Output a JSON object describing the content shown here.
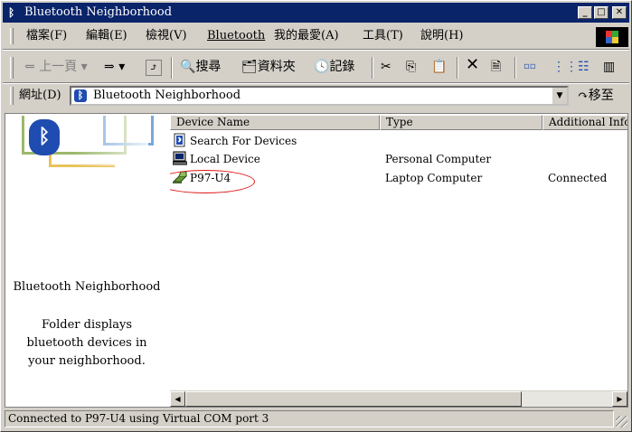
{
  "window": {
    "title": "Bluetooth Neighborhood",
    "title_icon": "bluetooth-icon",
    "controls": {
      "minimize": "_",
      "maximize": "□",
      "close": "✕"
    }
  },
  "menu": {
    "items": [
      "檔案(F)",
      "編輯(E)",
      "檢視(V)",
      "Bluetooth",
      "我的最愛(A)",
      "工具(T)",
      "說明(H)"
    ]
  },
  "toolbar": {
    "back_label": "上一頁",
    "forward_icon": "⇒",
    "dropdown_icon": "▾",
    "up_icon": "⤴",
    "search_label": "搜尋",
    "folders_label": "資料夾",
    "history_label": "記錄",
    "cut_icon": "✂",
    "copy_icon": "⎘",
    "paste_icon": "📋",
    "delete_icon": "✕",
    "properties_icon": "🗎",
    "views_icons": [
      "▫▫",
      "⋮⋮",
      "☷",
      "▥"
    ]
  },
  "address": {
    "label": "網址(D)",
    "value": "Bluetooth Neighborhood",
    "go_label": "移至"
  },
  "left_pane": {
    "title": "Bluetooth Neighborhood",
    "description": "Folder displays bluetooth devices in your neighborhood."
  },
  "list": {
    "columns": [
      "Device Name",
      "Type",
      "Additional Information"
    ],
    "rows": [
      {
        "name": "Search For Devices",
        "type": "",
        "info": "",
        "icon": "bluetooth-search-icon"
      },
      {
        "name": "Local Device",
        "type": "Personal Computer",
        "info": "",
        "icon": "computer-icon"
      },
      {
        "name": "P97-U4",
        "type": "Laptop Computer",
        "info": "Connected",
        "icon": "laptop-icon"
      }
    ]
  },
  "status": {
    "text": "Connected to P97-U4 using Virtual COM port 3"
  },
  "colors": {
    "title_bar": "#0a246a",
    "highlight_ellipse": "#e01818",
    "bluetooth_blue": "#1f4cb0"
  }
}
